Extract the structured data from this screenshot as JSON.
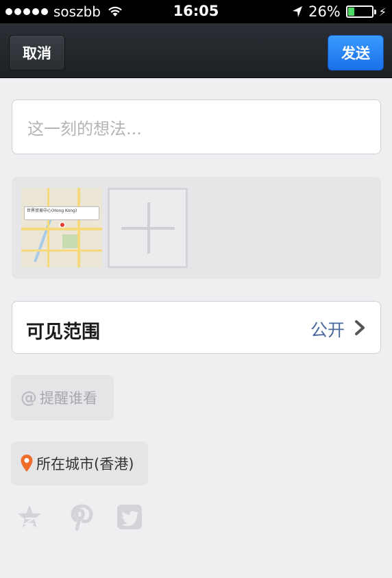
{
  "status_bar": {
    "carrier": "soszbb",
    "time": "16:05",
    "battery": "26%",
    "battery_level": 0.26
  },
  "nav": {
    "cancel_label": "取消",
    "send_label": "发送"
  },
  "composer": {
    "placeholder": "这一刻的想法..."
  },
  "photos": {
    "map_callout": "世界贸易中心(Hong Kong)"
  },
  "visibility": {
    "label": "可见范围",
    "value": "公开"
  },
  "remind": {
    "at_symbol": "@",
    "label": "提醒谁看"
  },
  "location": {
    "label": "所在城市(香港)"
  },
  "colors": {
    "send_button": "#1a7cf0",
    "visibility_value": "#4a6a9e",
    "location_pin": "#ef6c2a"
  }
}
